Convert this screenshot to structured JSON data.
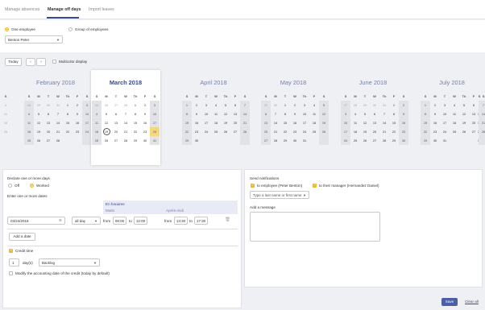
{
  "tabs": [
    {
      "label": "Manage absences"
    },
    {
      "label": "Manage off days"
    },
    {
      "label": "Import leaves"
    }
  ],
  "filters": {
    "one_employee": "One employee",
    "group_of_employees": "Group of employees",
    "employee": "Benton Peter"
  },
  "toolbar": {
    "today": "Today",
    "prev": "‹",
    "next": "›",
    "multicolor": "Multicolor display"
  },
  "weekdays": [
    "S",
    "M",
    "T",
    "W",
    "Th",
    "F",
    "S"
  ],
  "edge_left": [
    "S",
    "4",
    "11",
    "18",
    "25"
  ],
  "edge_right": [
    "S",
    "3",
    "10",
    "17",
    "24",
    "31"
  ],
  "months": [
    {
      "title": "February 2018",
      "rows": [
        [
          "28",
          "29",
          "30",
          "31",
          "1",
          "2",
          "3"
        ],
        [
          "4",
          "5",
          "6",
          "7",
          "8",
          "9",
          "10"
        ],
        [
          "11",
          "12",
          "13",
          "14",
          "15",
          "16",
          "17"
        ],
        [
          "18",
          "19",
          "20",
          "21",
          "22",
          "23",
          "24"
        ],
        [
          "25",
          "26",
          "27",
          "28",
          "",
          "",
          ""
        ]
      ]
    },
    {
      "title": "March 2018",
      "rows": [
        [
          "25",
          "26",
          "27",
          "28",
          "1",
          "2",
          "3"
        ],
        [
          "4",
          "5",
          "6",
          "7",
          "8",
          "9",
          "10"
        ],
        [
          "11",
          "12",
          "13",
          "14",
          "15",
          "16",
          "17"
        ],
        [
          "18",
          "19",
          "20",
          "21",
          "22",
          "23",
          "24"
        ],
        [
          "25",
          "26",
          "27",
          "28",
          "29",
          "30",
          "31"
        ]
      ]
    },
    {
      "title": "April 2018",
      "rows": [
        [
          "1",
          "2",
          "3",
          "4",
          "5",
          "6",
          "7"
        ],
        [
          "8",
          "9",
          "10",
          "11",
          "12",
          "13",
          "14"
        ],
        [
          "15",
          "16",
          "17",
          "18",
          "19",
          "20",
          "21"
        ],
        [
          "22",
          "23",
          "24",
          "25",
          "26",
          "27",
          "28"
        ],
        [
          "29",
          "30",
          "",
          "",
          "",
          "",
          ""
        ]
      ]
    },
    {
      "title": "May 2018",
      "rows": [
        [
          "29",
          "30",
          "1",
          "2",
          "3",
          "4",
          "5"
        ],
        [
          "6",
          "7",
          "8",
          "9",
          "10",
          "11",
          "12"
        ],
        [
          "13",
          "14",
          "15",
          "16",
          "17",
          "18",
          "19"
        ],
        [
          "20",
          "21",
          "22",
          "23",
          "24",
          "25",
          "26"
        ],
        [
          "27",
          "28",
          "29",
          "30",
          "31",
          "",
          ""
        ]
      ]
    },
    {
      "title": "June 2018",
      "rows": [
        [
          "27",
          "28",
          "29",
          "30",
          "31",
          "1",
          "2"
        ],
        [
          "3",
          "4",
          "5",
          "6",
          "7",
          "8",
          "9"
        ],
        [
          "10",
          "11",
          "12",
          "13",
          "14",
          "15",
          "16"
        ],
        [
          "17",
          "18",
          "19",
          "20",
          "21",
          "22",
          "23"
        ],
        [
          "24",
          "25",
          "26",
          "27",
          "28",
          "29",
          "30"
        ]
      ]
    },
    {
      "title": "July 2018",
      "rows": [
        [
          "1",
          "2",
          "3",
          "4",
          "5",
          "6",
          "7"
        ],
        [
          "8",
          "9",
          "10",
          "11",
          "12",
          "13",
          "14"
        ],
        [
          "15",
          "16",
          "17",
          "18",
          "19",
          "20",
          "21"
        ],
        [
          "22",
          "23",
          "24",
          "25",
          "26",
          "27",
          "28"
        ],
        [
          "29",
          "30",
          "31",
          "",
          "",
          "",
          ""
        ]
      ]
    }
  ],
  "declare": {
    "title": "Declare one or more days",
    "off": "Off",
    "worked": "Worked",
    "enter_dates": "Enter one or more dates",
    "hours_header": "En horaires",
    "morning": "Matin",
    "afternoon": "Après-midi",
    "date": "03/24/2018",
    "period": "all day",
    "from": "from",
    "to": "to",
    "am_from": "08:00",
    "am_to": "12:00",
    "pm_from": "13:30",
    "pm_to": "17:30",
    "add_date": "Add a date",
    "credit_time": "Credit time",
    "days_value": "1",
    "days_unit": "day(s)",
    "backlog": "Backlog",
    "modify_accounting": "Modify the accounting date of the credit (today by default)"
  },
  "notify": {
    "title": "Send notifications",
    "to_employee": "to employee (Peter Benton)",
    "to_manager": "to their manager (Hernandez Daniel)",
    "recipient_placeholder": "Type a last name or first name",
    "add_message": "Add a message"
  },
  "actions": {
    "save": "Save",
    "clear_all": "Clear all"
  },
  "colors": {
    "accent": "#3b4b8c",
    "selected_day": "#f6d77a",
    "checkbox": "#e8b735"
  }
}
